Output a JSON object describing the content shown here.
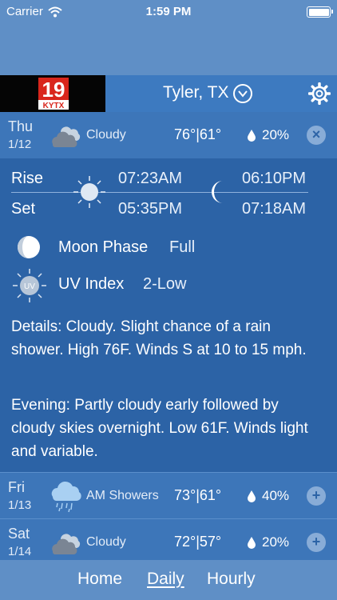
{
  "status_bar": {
    "carrier": "Carrier",
    "time": "1:59 PM"
  },
  "header": {
    "city": "Tyler, TX",
    "logo_text": "KYTX",
    "logo_number": "19"
  },
  "expanded_day": {
    "day": "Thu",
    "date": "1/12",
    "icon": "cloudy-icon",
    "condition": "Cloudy",
    "temps": "76°|61°",
    "precip": "20%",
    "action": "×"
  },
  "sun_moon": {
    "rise_label": "Rise",
    "set_label": "Set",
    "sunrise": "07:23AM",
    "sunset": "05:35PM",
    "moonrise": "06:10PM",
    "moonset": "07:18AM"
  },
  "moon_phase": {
    "label": "Moon Phase",
    "value": "Full"
  },
  "uv_index": {
    "label": "UV Index",
    "value": "2-Low",
    "icon_text": "UV"
  },
  "details": "Details: Cloudy. Slight chance of a rain shower. High 76F. Winds S at 10 to 15 mph.",
  "evening": "Evening: Partly cloudy early followed by cloudy skies overnight. Low 61F. Winds light and variable.",
  "forecast": [
    {
      "day": "Fri",
      "date": "1/13",
      "icon": "rain-icon",
      "condition": "AM Showers",
      "temps": "73°|61°",
      "precip": "40%",
      "action": "+"
    },
    {
      "day": "Sat",
      "date": "1/14",
      "icon": "cloudy-icon",
      "condition": "Cloudy",
      "temps": "72°|57°",
      "precip": "20%",
      "action": "+"
    }
  ],
  "tabs": {
    "home": "Home",
    "daily": "Daily",
    "hourly": "Hourly",
    "active": "Daily"
  },
  "colors": {
    "background": "#2c63a6",
    "header": "#3d7ac0",
    "topbar": "#5f8fc6",
    "row": "#3d76b9",
    "logo_red": "#d9261c"
  }
}
